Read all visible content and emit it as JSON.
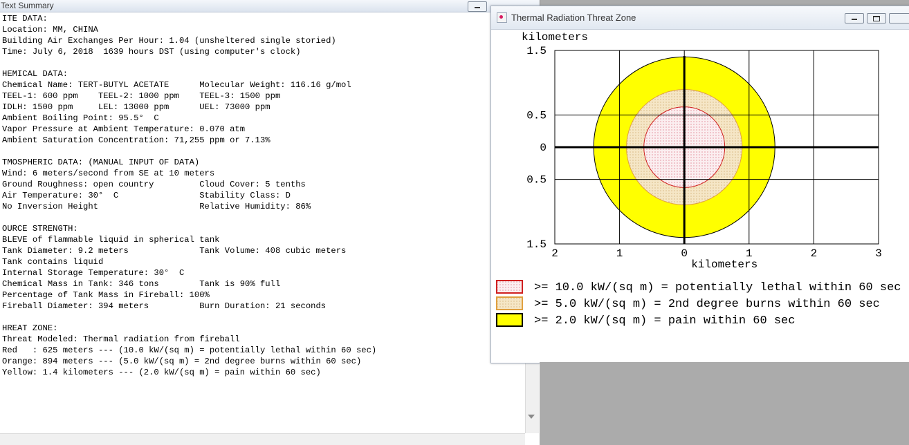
{
  "text_summary": {
    "title": "Text Summary",
    "lines": [
      "ITE DATA:",
      "Location: MM, CHINA",
      "Building Air Exchanges Per Hour: 1.04 (unsheltered single storied)",
      "Time: July 6, 2018  1639 hours DST (using computer's clock)",
      "",
      "HEMICAL DATA:",
      "Chemical Name: TERT-BUTYL ACETATE      Molecular Weight: 116.16 g/mol",
      "TEEL-1: 600 ppm    TEEL-2: 1000 ppm    TEEL-3: 1500 ppm",
      "IDLH: 1500 ppm     LEL: 13000 ppm      UEL: 73000 ppm",
      "Ambient Boiling Point: 95.5°  C",
      "Vapor Pressure at Ambient Temperature: 0.070 atm",
      "Ambient Saturation Concentration: 71,255 ppm or 7.13%",
      "",
      "TMOSPHERIC DATA: (MANUAL INPUT OF DATA)",
      "Wind: 6 meters/second from SE at 10 meters",
      "Ground Roughness: open country         Cloud Cover: 5 tenths",
      "Air Temperature: 30°  C                Stability Class: D",
      "No Inversion Height                    Relative Humidity: 86%",
      "",
      "OURCE STRENGTH:",
      "BLEVE of flammable liquid in spherical tank",
      "Tank Diameter: 9.2 meters              Tank Volume: 408 cubic meters",
      "Tank contains liquid",
      "Internal Storage Temperature: 30°  C",
      "Chemical Mass in Tank: 346 tons        Tank is 90% full",
      "Percentage of Tank Mass in Fireball: 100%",
      "Fireball Diameter: 394 meters          Burn Duration: 21 seconds",
      "",
      "HREAT ZONE:",
      "Threat Modeled: Thermal radiation from fireball",
      "Red   : 625 meters --- (10.0 kW/(sq m) = potentially lethal within 60 sec)",
      "Orange: 894 meters --- (5.0 kW/(sq m) = 2nd degree burns within 60 sec)",
      "Yellow: 1.4 kilometers --- (2.0 kW/(sq m) = pain within 60 sec)"
    ]
  },
  "threat_zone": {
    "title": "Thermal Radiation Threat Zone",
    "legend": [
      {
        "label": ">= 10.0 kW/(sq m) = potentially lethal within 60 sec",
        "color": "#e02020"
      },
      {
        "label": ">= 5.0 kW/(sq m) = 2nd degree burns within 60 sec",
        "color": "#f0a030"
      },
      {
        "label": ">= 2.0 kW/(sq m) = pain within 60 sec",
        "color": "#ffff00"
      }
    ]
  },
  "chart_data": {
    "type": "area",
    "xlabel": "kilometers",
    "ylabel": "kilometers",
    "xlim": [
      -2,
      3
    ],
    "ylim": [
      -1.5,
      1.5
    ],
    "x_ticks": [
      -2,
      -1,
      0,
      1,
      2,
      3
    ],
    "x_tick_labels": [
      "2",
      "1",
      "0",
      "1",
      "2",
      "3"
    ],
    "y_ticks": [
      1.5,
      0.5,
      0,
      -0.5,
      -1.5
    ],
    "y_tick_labels": [
      "1.5",
      "0.5",
      "0",
      "0.5",
      "1.5"
    ],
    "grid": true,
    "zones": [
      {
        "name": "Yellow",
        "radius_km": 1.4,
        "fill": "#ffff00",
        "stroke": "#000000"
      },
      {
        "name": "Orange",
        "radius_km": 0.894,
        "fill": "#f3e3c3",
        "stroke": "#e0a040"
      },
      {
        "name": "Red",
        "radius_km": 0.625,
        "fill": "#fbeef0",
        "stroke": "#d02020"
      }
    ],
    "center": [
      0,
      0
    ]
  }
}
